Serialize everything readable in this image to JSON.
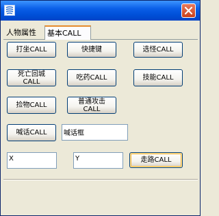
{
  "window": {
    "title": ""
  },
  "tabs": [
    {
      "label": "人物属性"
    },
    {
      "label": "基本CALL"
    }
  ],
  "buttons": {
    "sit": "打坐CALL",
    "hotkey": "快捷键",
    "select_monster": "选怪CALL",
    "revive_line1": "死亡回城",
    "revive_line2": "CALL",
    "eat_medicine": "吃药CALL",
    "skill": "技能CALL",
    "pickup": "捡物CALL",
    "attack_line1": "普通攻击",
    "attack_line2": "CALL",
    "shout": "喊话CALL",
    "walk": "走路CALL"
  },
  "inputs": {
    "shout_box": "喊话框",
    "x": "X",
    "y": "Y"
  }
}
